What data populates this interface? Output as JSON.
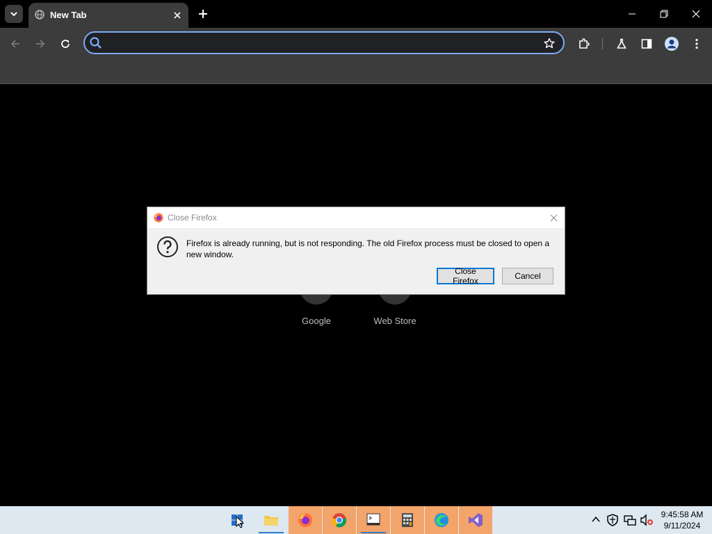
{
  "browser": {
    "tab_title": "New Tab",
    "address_value": "",
    "address_placeholder": ""
  },
  "shortcuts": [
    {
      "label": "Google"
    },
    {
      "label": "Web Store"
    }
  ],
  "dialog": {
    "title": "Close Firefox",
    "message": "Firefox is already running, but is not responding. The old Firefox process must be closed to open a new window.",
    "primary_button": "Close Firefox",
    "secondary_button": "Cancel"
  },
  "taskbar": {
    "apps": [
      "start",
      "file-explorer",
      "firefox",
      "chrome",
      "terminal",
      "calculator",
      "edge",
      "visual-studio"
    ],
    "clock_time": "9:45:58 AM",
    "clock_date": "9/11/2024"
  },
  "colors": {
    "focus_ring": "#7cacf8",
    "taskbar_highlight": "#f3a46a",
    "dialog_default_border": "#0078d7"
  }
}
